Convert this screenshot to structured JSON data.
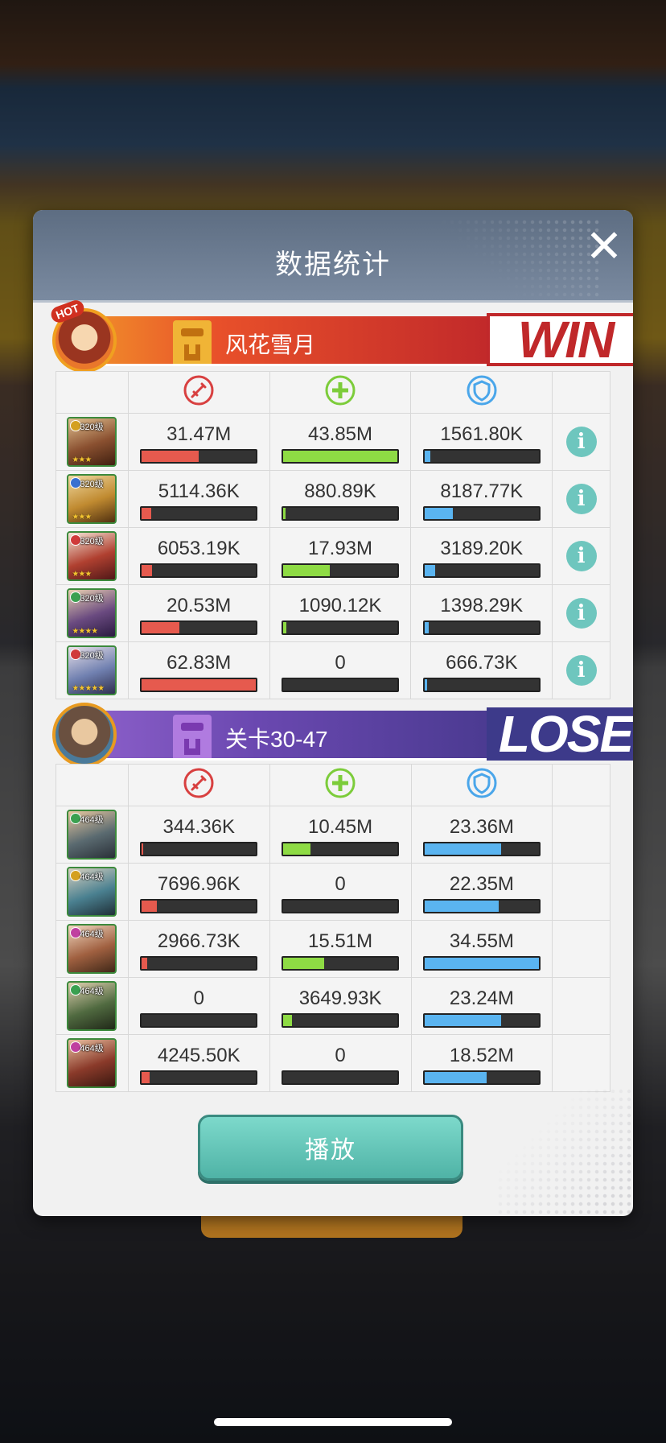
{
  "dialog": {
    "title": "数据统计",
    "play_label": "播放"
  },
  "winner": {
    "name": "风花雪月",
    "result": "WIN",
    "hot_label": "HOT",
    "heroes": [
      {
        "level": "320级",
        "damage": "31.47M",
        "damage_frac": 0.5,
        "heal": "43.85M",
        "heal_frac": 1.0,
        "defense": "1561.80K",
        "defense_frac": 0.05,
        "stars": "★★★",
        "elem_color": "#d4a020"
      },
      {
        "level": "320级",
        "damage": "5114.36K",
        "damage_frac": 0.08,
        "heal": "880.89K",
        "heal_frac": 0.02,
        "defense": "8187.77K",
        "defense_frac": 0.25,
        "stars": "★★★",
        "elem_color": "#3a70d0"
      },
      {
        "level": "320级",
        "damage": "6053.19K",
        "damage_frac": 0.09,
        "heal": "17.93M",
        "heal_frac": 0.41,
        "defense": "3189.20K",
        "defense_frac": 0.09,
        "stars": "★★★",
        "elem_color": "#d03a3a"
      },
      {
        "level": "320级",
        "damage": "20.53M",
        "damage_frac": 0.33,
        "heal": "1090.12K",
        "heal_frac": 0.03,
        "defense": "1398.29K",
        "defense_frac": 0.04,
        "stars": "★★★★",
        "elem_color": "#3aa050"
      },
      {
        "level": "320级",
        "damage": "62.83M",
        "damage_frac": 1.0,
        "heal": "0",
        "heal_frac": 0,
        "defense": "666.73K",
        "defense_frac": 0.02,
        "stars": "★★★★★",
        "elem_color": "#d03a3a"
      }
    ]
  },
  "loser": {
    "name": "关卡30-47",
    "result": "LOSE",
    "heroes": [
      {
        "level": "464级",
        "damage": "344.36K",
        "damage_frac": 0.01,
        "heal": "10.45M",
        "heal_frac": 0.24,
        "defense": "23.36M",
        "defense_frac": 0.67,
        "elem_color": "#3aa050"
      },
      {
        "level": "464级",
        "damage": "7696.96K",
        "damage_frac": 0.13,
        "heal": "0",
        "heal_frac": 0,
        "defense": "22.35M",
        "defense_frac": 0.65,
        "elem_color": "#d4a020"
      },
      {
        "level": "464级",
        "damage": "2966.73K",
        "damage_frac": 0.05,
        "heal": "15.51M",
        "heal_frac": 0.36,
        "defense": "34.55M",
        "defense_frac": 1.0,
        "elem_color": "#c040a0"
      },
      {
        "level": "464级",
        "damage": "0",
        "damage_frac": 0,
        "heal": "3649.93K",
        "heal_frac": 0.08,
        "defense": "23.24M",
        "defense_frac": 0.67,
        "elem_color": "#3aa050"
      },
      {
        "level": "464级",
        "damage": "4245.50K",
        "damage_frac": 0.07,
        "heal": "0",
        "heal_frac": 0,
        "defense": "18.52M",
        "defense_frac": 0.54,
        "elem_color": "#c040a0"
      }
    ]
  },
  "columns": {
    "damage_icon": "sword-icon",
    "heal_icon": "cross-plus-icon",
    "defense_icon": "shield-icon",
    "info_icon": "info-icon"
  },
  "colors": {
    "damage": "#e65a4e",
    "heal": "#8edb44",
    "defense": "#5ab4f0",
    "info": "#6ec6be"
  }
}
